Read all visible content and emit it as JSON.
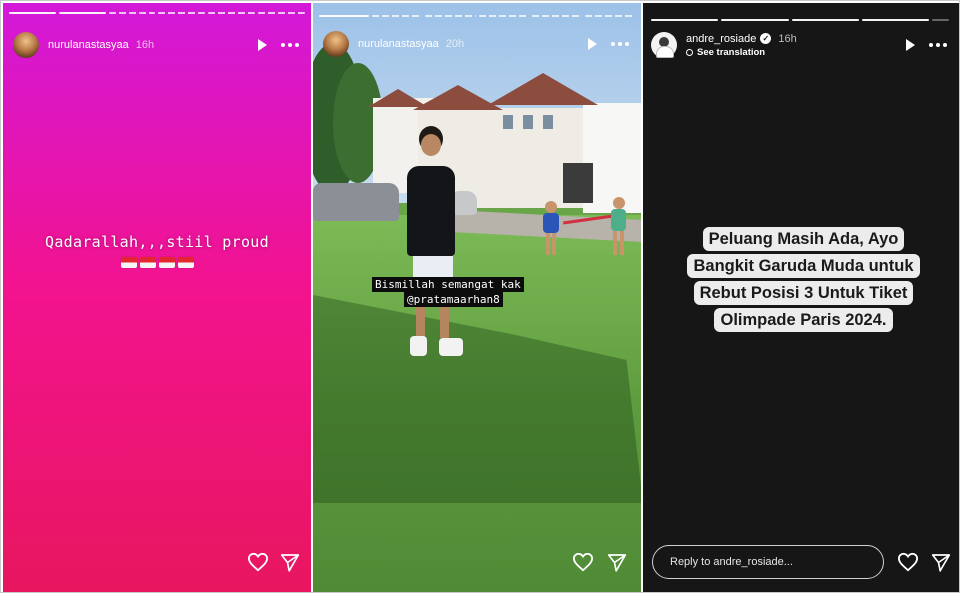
{
  "stories": [
    {
      "username": "nurulanastasyaa",
      "time": "16h",
      "caption": "Qadarallah,,,stiil proud",
      "progress": [
        "done",
        "done",
        "dash",
        "dash",
        "dash",
        "dash"
      ]
    },
    {
      "username": "nurulanastasyaa",
      "time": "20h",
      "caption_lines": [
        "Bismillah semangat kak",
        "@pratamaarhan8"
      ],
      "progress": [
        "done",
        "dash",
        "dash",
        "dash",
        "dash",
        "dash"
      ]
    },
    {
      "username": "andre_rosiade",
      "time": "16h",
      "see_translation": "See translation",
      "caption_lines": [
        "Peluang Masih Ada, Ayo",
        "Bangkit Garuda Muda untuk",
        "Rebut Posisi 3 Untuk Tiket",
        "Olimpade Paris 2024."
      ],
      "reply_placeholder": "Reply to andre_rosiade...",
      "progress": [
        "done",
        "done",
        "done",
        "done",
        "seg"
      ]
    }
  ],
  "icons": {
    "play": "play-icon",
    "more": "more-icon",
    "like": "heart-icon",
    "share": "send-icon",
    "verified": "verified-badge-icon"
  },
  "colors": {
    "story1_top": "#d318d9",
    "story1_bottom": "#e8165f",
    "story3_bg": "#161616"
  }
}
